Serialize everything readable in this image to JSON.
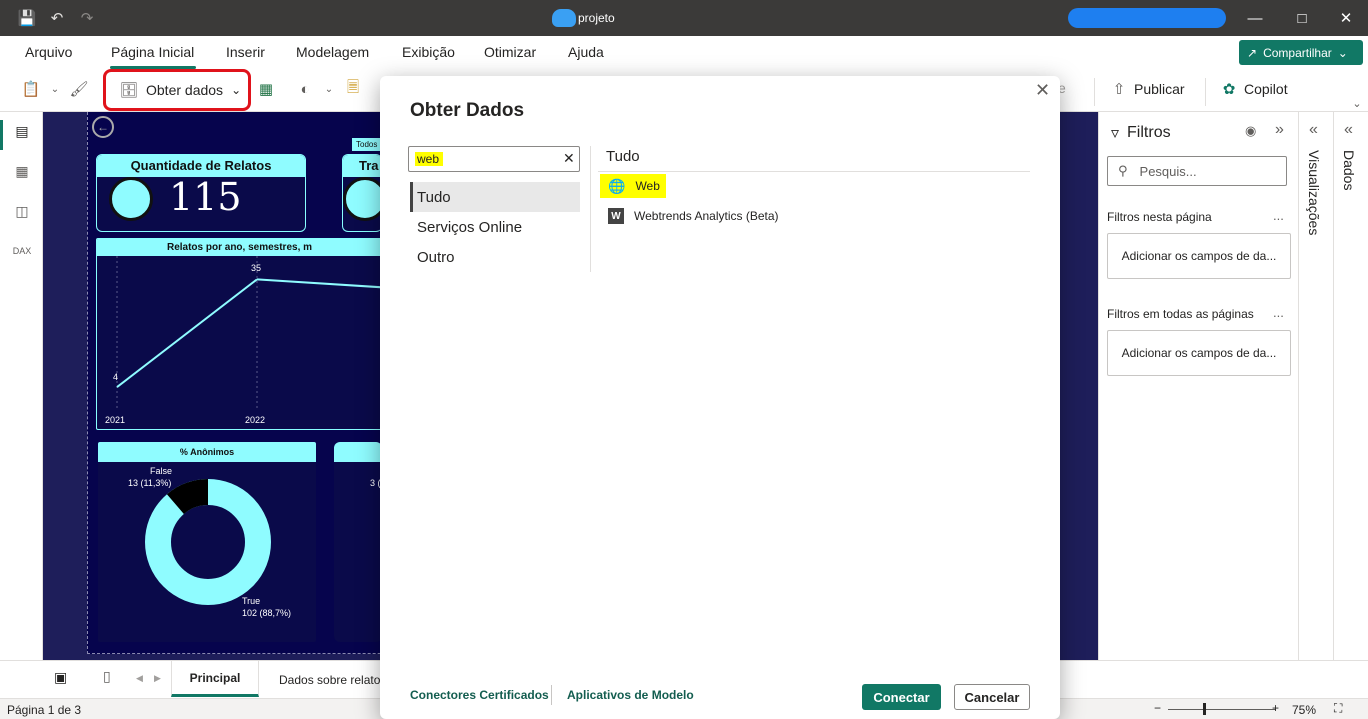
{
  "window": {
    "title": "projeto"
  },
  "menu": {
    "items": [
      "Arquivo",
      "Página Inicial",
      "Inserir",
      "Modelagem",
      "Exibição",
      "Otimizar",
      "Ajuda"
    ],
    "share_label": "Compartilhar"
  },
  "toolbar": {
    "get_data_label": "Obter dados",
    "publish_label": "Publicar",
    "copilot_label": "Copilot"
  },
  "report": {
    "kpi_card_title": "Quantidade de Relatos",
    "kpi_value": "115",
    "card2_title_partial": "Tra",
    "tooltip_partial": "Todos",
    "line_chart_title": "Relatos por ano, semestres, m",
    "line_chart": {
      "x": [
        "2021",
        "2022"
      ],
      "y": [
        4,
        35
      ],
      "labels": [
        "4",
        "35"
      ]
    },
    "donut_title": "% Anônimos",
    "donut": {
      "false_label": "False",
      "false_value": "13 (11,3%)",
      "true_label": "True",
      "true_value": "102 (88,7%)"
    },
    "card4_partial_value": "3 ("
  },
  "filters": {
    "title": "Filtros",
    "search_placeholder": "Pesquis...",
    "this_page_label": "Filtros nesta página",
    "this_page_drop": "Adicionar os campos de da...",
    "all_pages_label": "Filtros em todas as páginas",
    "all_pages_drop": "Adicionar os campos de da...",
    "more": "..."
  },
  "panes": {
    "visualizations": "Visualizações",
    "data": "Dados"
  },
  "page_tabs": {
    "tabs": [
      "Principal",
      "Dados sobre relato"
    ]
  },
  "status": {
    "page_indicator": "Página 1 de 3",
    "zoom": "75%"
  },
  "modal": {
    "title": "Obter Dados",
    "search_value": "web",
    "categories": [
      "Tudo",
      "Serviços Online",
      "Outro"
    ],
    "results_title": "Tudo",
    "results": [
      "Web",
      "Webtrends Analytics (Beta)"
    ],
    "footer_links": [
      "Conectores Certificados",
      "Aplicativos de Modelo"
    ],
    "connect_label": "Conectar",
    "cancel_label": "Cancelar"
  },
  "colors": {
    "accent": "#117865",
    "canvas_bg": "#06044d",
    "highlight": "#ffff00",
    "annotation_red": "#e0131b",
    "chart_cyan": "#8ffcff"
  }
}
